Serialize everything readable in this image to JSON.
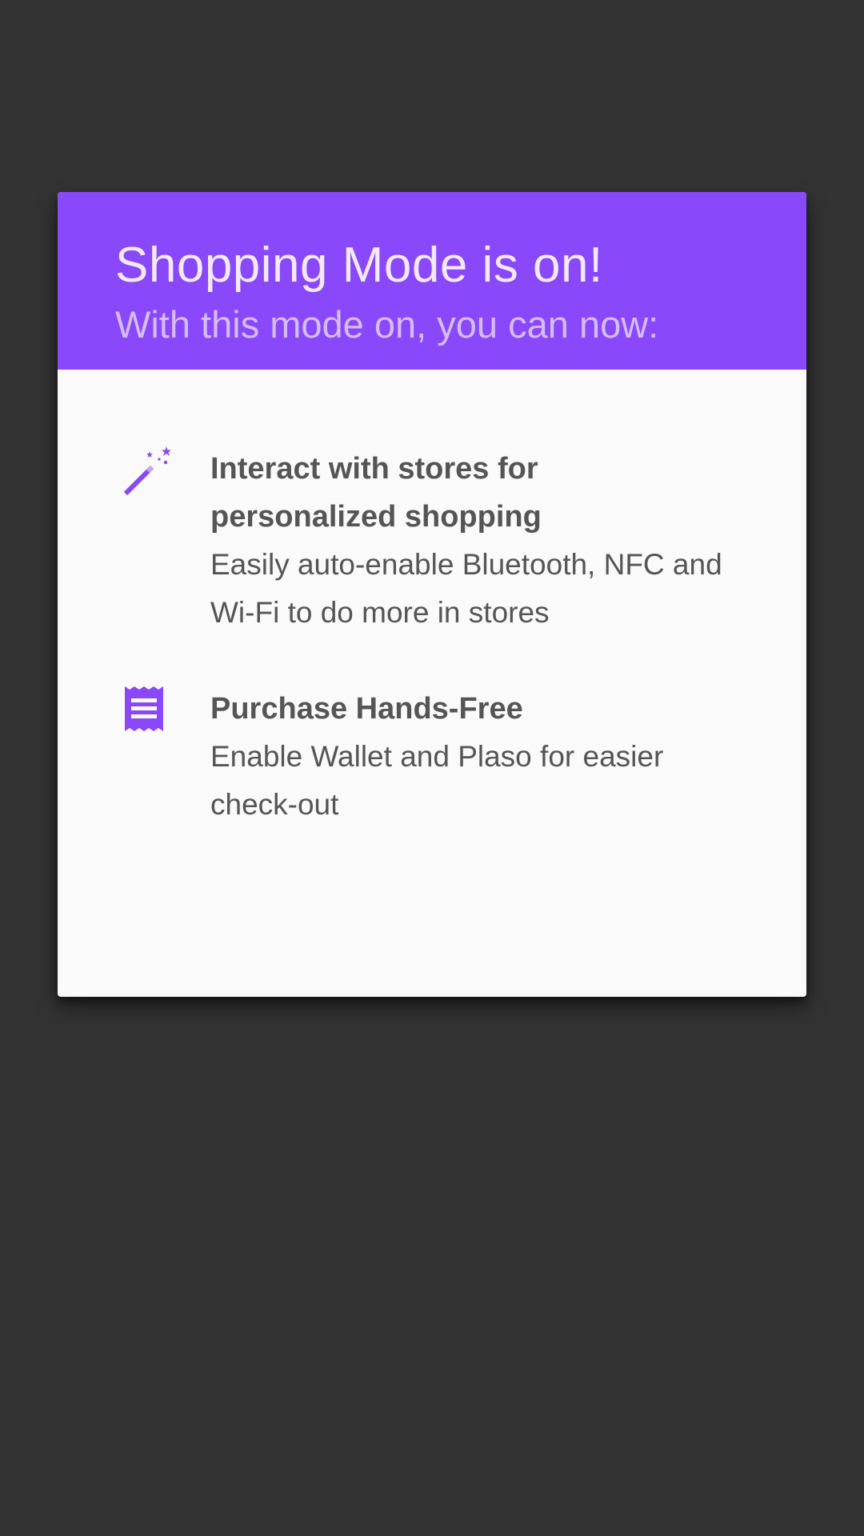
{
  "dialog": {
    "title": "Shopping Mode is on!",
    "subtitle": "With this mode on, you can now:",
    "header_color": "#8a48fb",
    "icon_color": "#8a48fb"
  },
  "features": [
    {
      "icon": "magic-wand-icon",
      "title": "Interact with stores for personalized shopping",
      "description": "Easily auto-enable Bluetooth, NFC and Wi-Fi to do more in stores"
    },
    {
      "icon": "receipt-icon",
      "title": "Purchase Hands-Free",
      "description": "Enable Wallet and Plaso for easier check-out"
    }
  ]
}
